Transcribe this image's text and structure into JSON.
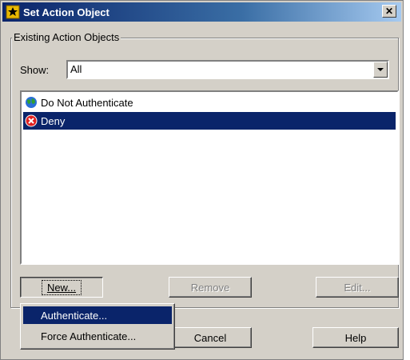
{
  "window": {
    "title": "Set Action Object",
    "close_glyph": "✕"
  },
  "group": {
    "label": "Existing Action Objects"
  },
  "show": {
    "label": "Show:",
    "value": "All"
  },
  "list": {
    "items": [
      {
        "label": "Do Not Authenticate",
        "icon": "globe-icon",
        "selected": false
      },
      {
        "label": "Deny",
        "icon": "deny-icon",
        "selected": true
      }
    ]
  },
  "buttons": {
    "new_label": "New...",
    "remove_label": "Remove",
    "edit_label": "Edit...",
    "cancel_label": "Cancel",
    "help_label": "Help"
  },
  "menu": {
    "items": [
      {
        "label": "Authenticate...",
        "highlighted": true
      },
      {
        "label": "Force Authenticate...",
        "highlighted": false
      }
    ]
  },
  "colors": {
    "selection": "#0a246a",
    "dialog_bg": "#d4d0c8"
  }
}
